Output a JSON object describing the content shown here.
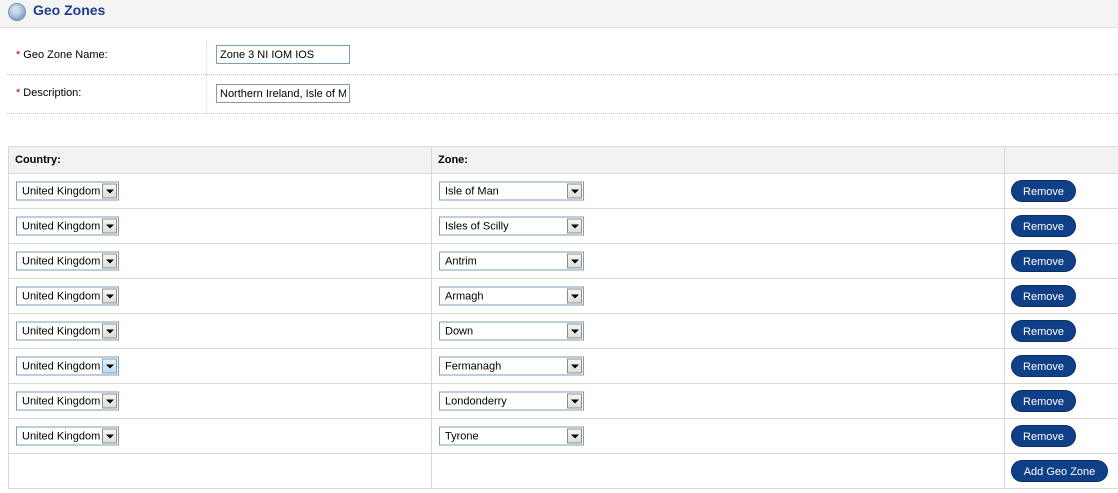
{
  "header": {
    "title": "Geo Zones",
    "icon": "globe-icon"
  },
  "form": {
    "required_mark": "*",
    "name_label": "Geo Zone Name:",
    "name_value": "Zone 3 NI IOM IOS",
    "description_label": "Description:",
    "description_value": "Northern Ireland, Isle of Man, Isles of Scilly"
  },
  "table": {
    "country_header": "Country:",
    "zone_header": "Zone:",
    "action_header": "",
    "rows": [
      {
        "country": "United Kingdom",
        "zone": "Isle of Man",
        "remove": "Remove"
      },
      {
        "country": "United Kingdom",
        "zone": "Isles of Scilly",
        "remove": "Remove"
      },
      {
        "country": "United Kingdom",
        "zone": "Antrim",
        "remove": "Remove"
      },
      {
        "country": "United Kingdom",
        "zone": "Armagh",
        "remove": "Remove"
      },
      {
        "country": "United Kingdom",
        "zone": "Down",
        "remove": "Remove"
      },
      {
        "country": "United Kingdom",
        "zone": "Fermanagh",
        "remove": "Remove"
      },
      {
        "country": "United Kingdom",
        "zone": "Londonderry",
        "remove": "Remove"
      },
      {
        "country": "United Kingdom",
        "zone": "Tyrone",
        "remove": "Remove"
      }
    ],
    "add_button": "Add Geo Zone"
  },
  "colors": {
    "title": "#1d3e8a",
    "required": "#c00000",
    "button": "#0f3f87"
  }
}
